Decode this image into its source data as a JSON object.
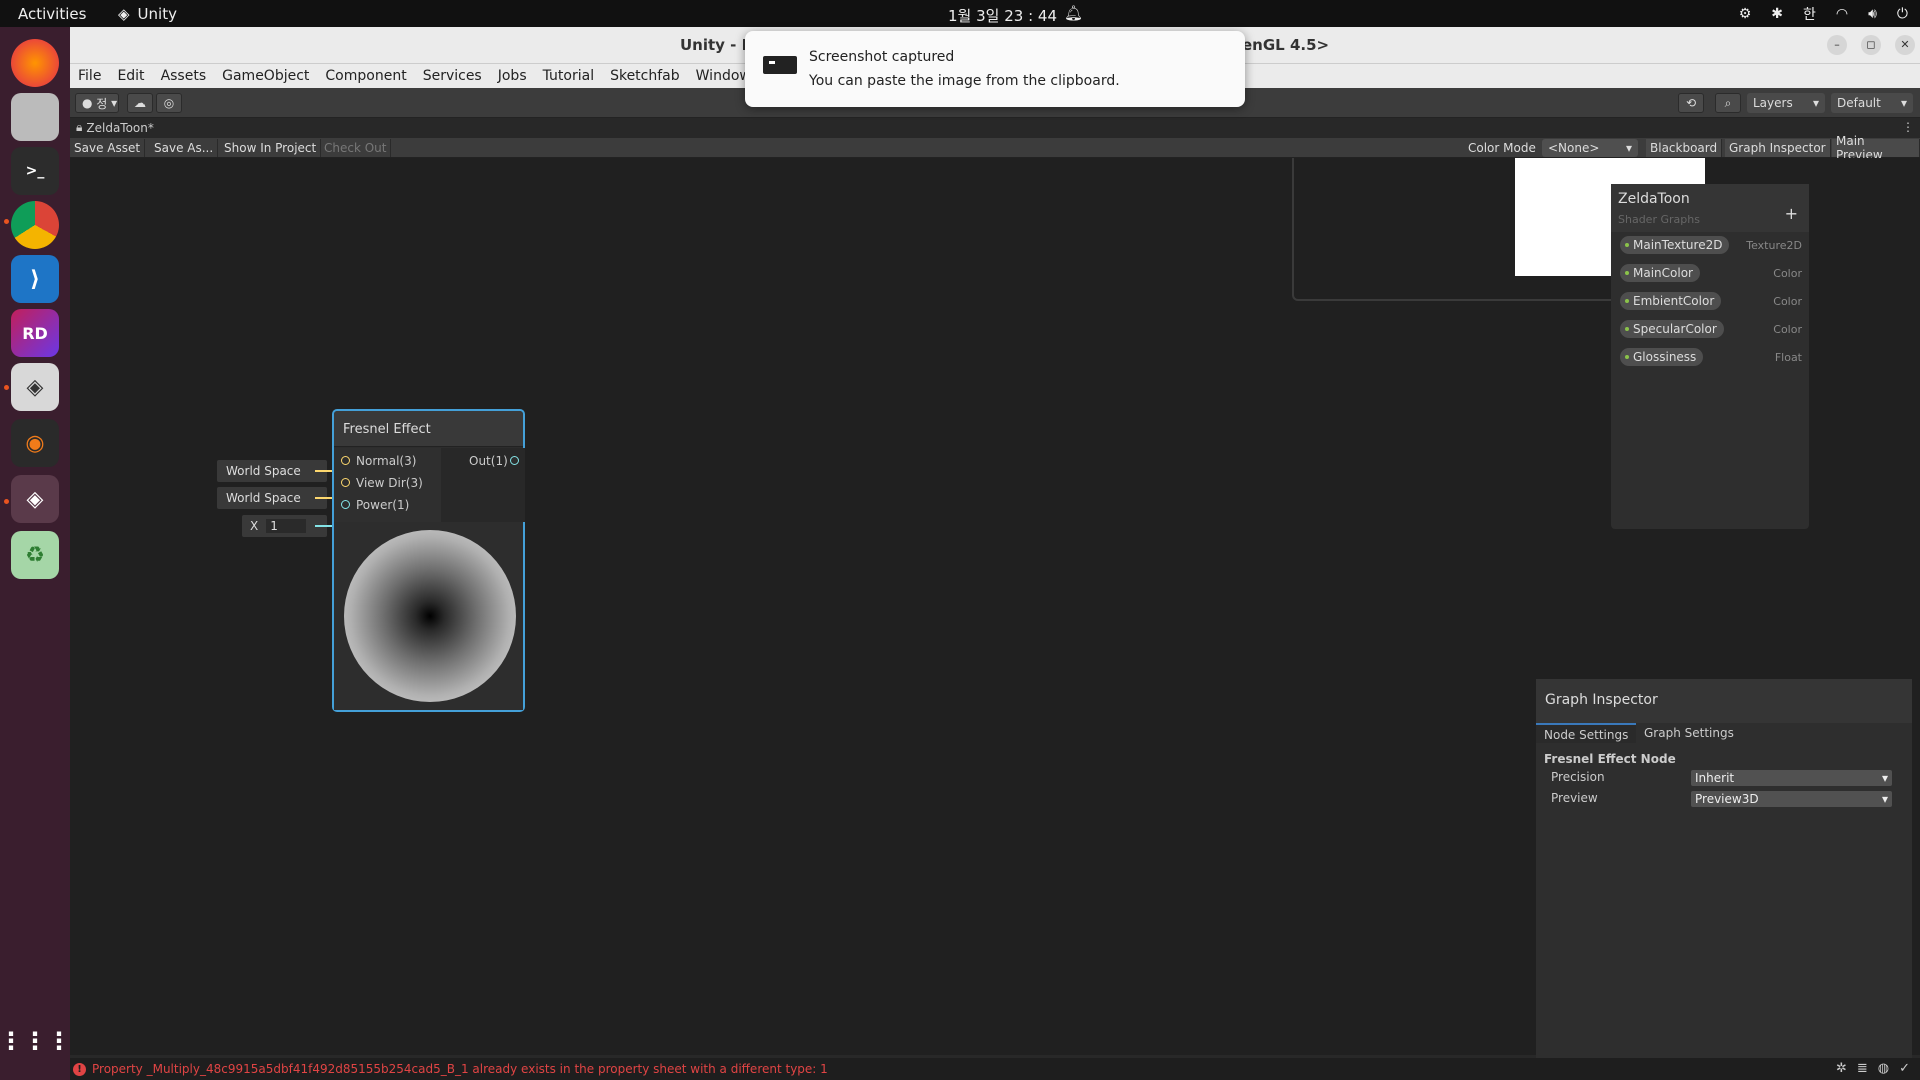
{
  "system": {
    "activities": "Activities",
    "app_name": "Unity",
    "clock": "1월 3일 23 : 44",
    "ime": "한"
  },
  "window": {
    "title_left": "Unity - M",
    "title_right": "enGL 4.5>"
  },
  "menu": [
    "File",
    "Edit",
    "Assets",
    "GameObject",
    "Component",
    "Services",
    "Jobs",
    "Tutorial",
    "Sketchfab",
    "Window"
  ],
  "toolbar": {
    "account_label": "정",
    "layers": "Layers",
    "layout": "Default"
  },
  "tab": {
    "label": "ZeldaToon*"
  },
  "graph_toolbar": {
    "save_asset": "Save Asset",
    "save_as": "Save As...",
    "show_in_project": "Show In Project",
    "check_out": "Check Out",
    "color_mode_label": "Color Mode",
    "color_mode_value": "<None>",
    "blackboard": "Blackboard",
    "graph_inspector": "Graph Inspector",
    "main_preview": "Main Preview"
  },
  "node": {
    "title": "Fresnel Effect",
    "inputs": [
      {
        "label": "Normal(3)",
        "default": "World Space"
      },
      {
        "label": "View Dir(3)",
        "default": "World Space"
      },
      {
        "label": "Power(1)",
        "axis": "X",
        "value": "1"
      }
    ],
    "output": "Out(1)"
  },
  "blackboard": {
    "title": "ZeldaToon",
    "subtitle": "Shader Graphs",
    "properties": [
      {
        "name": "MainTexture2D",
        "type": "Texture2D"
      },
      {
        "name": "MainColor",
        "type": "Color"
      },
      {
        "name": "EmbientColor",
        "type": "Color"
      },
      {
        "name": "SpecularColor",
        "type": "Color"
      },
      {
        "name": "Glossiness",
        "type": "Float"
      }
    ]
  },
  "inspector": {
    "title": "Graph Inspector",
    "tabs": [
      "Node Settings",
      "Graph Settings"
    ],
    "section": "Fresnel Effect Node",
    "precision_label": "Precision",
    "precision_value": "Inherit",
    "preview_label": "Preview",
    "preview_value": "Preview3D"
  },
  "status": {
    "error": "Property _Multiply_48c9915a5dbf41f492d85155b254cad5_B_1 already exists in the property sheet with a different type: 1"
  },
  "notification": {
    "title": "Screenshot captured",
    "body": "You can paste the image from the clipboard."
  },
  "colors": {
    "accent": "#44a0d8",
    "dock": "#3a1e2e",
    "error": "#e04444",
    "port_vector3": "#fcd76e",
    "port_vector1": "#84e4e7"
  }
}
